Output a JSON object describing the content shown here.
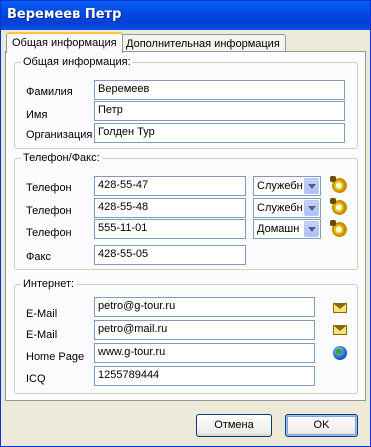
{
  "window": {
    "title": "Веремеев  Петр"
  },
  "tabs": [
    {
      "label": "Общая информация",
      "active": true
    },
    {
      "label": "Дополнительная информация",
      "active": false
    }
  ],
  "general": {
    "legend": "Общая информация:",
    "fields": [
      {
        "label": "Фамилия",
        "value": "Веремеев"
      },
      {
        "label": "Имя",
        "value": "Петр"
      },
      {
        "label": "Организация",
        "value": "Голден Тур"
      }
    ]
  },
  "phones": {
    "legend": "Телефон/Факс:",
    "rows": [
      {
        "label": "Телефон",
        "value": "428-55-47",
        "type": "Служебн"
      },
      {
        "label": "Телефон",
        "value": "428-55-48",
        "type": "Служебн"
      },
      {
        "label": "Телефон",
        "value": "555-11-01",
        "type": "Домашн"
      }
    ],
    "fax": {
      "label": "Факс",
      "value": "428-55-05"
    }
  },
  "internet": {
    "legend": "Интернет:",
    "rows": [
      {
        "label": "E-Mail",
        "value": "petro@g-tour.ru",
        "icon": "mail-icon"
      },
      {
        "label": "E-Mail",
        "value": "petro@mail.ru",
        "icon": "mail-icon"
      },
      {
        "label": "Home Page",
        "value": "www.g-tour.ru",
        "icon": "globe-icon"
      },
      {
        "label": "ICQ",
        "value": "1255789444"
      }
    ]
  },
  "buttons": {
    "cancel": "Отмена",
    "ok": "OK"
  }
}
